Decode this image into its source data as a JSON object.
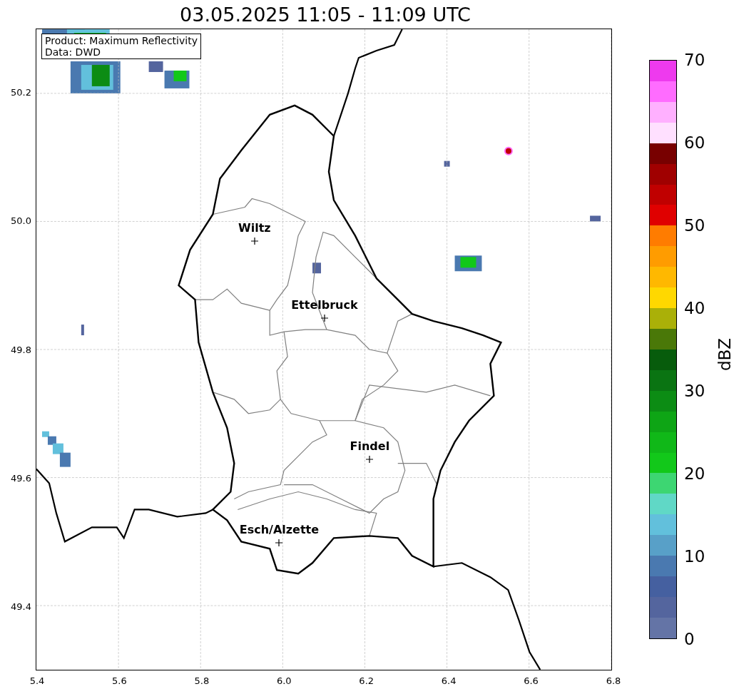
{
  "title": "03.05.2025 11:05 - 11:09 UTC",
  "info_box": [
    "Product: Maximum Reflectivity",
    "Data: DWD"
  ],
  "cities": [
    {
      "name": "Wiltz"
    },
    {
      "name": "Ettelbruck"
    },
    {
      "name": "Findel"
    },
    {
      "name": "Esch/Alzette"
    }
  ],
  "y_ticks": [
    "50.2",
    "50.0",
    "49.8",
    "49.6",
    "49.4"
  ],
  "colorbar": {
    "ticks": [
      "70",
      "60",
      "50",
      "40",
      "30",
      "20",
      "10",
      "0"
    ],
    "label": "dBZ",
    "bands": [
      {
        "color": "#ee3aee"
      },
      {
        "color": "#ff6cff"
      },
      {
        "color": "#ffb0ff"
      },
      {
        "color": "#ffe0ff"
      },
      {
        "color": "#780000"
      },
      {
        "color": "#a00000"
      },
      {
        "color": "#c00000"
      },
      {
        "color": "#e00000"
      },
      {
        "color": "#ff7c00"
      },
      {
        "color": "#ff9c00"
      },
      {
        "color": "#ffb800"
      },
      {
        "color": "#ffd800"
      },
      {
        "color": "#aab008"
      },
      {
        "color": "#4a7808"
      },
      {
        "color": "#075c0c"
      },
      {
        "color": "#0a7412"
      },
      {
        "color": "#0c8c14"
      },
      {
        "color": "#0ea515"
      },
      {
        "color": "#10b818"
      },
      {
        "color": "#12c81a"
      },
      {
        "color": "#3dd672"
      },
      {
        "color": "#60d8c6"
      },
      {
        "color": "#62c0dc"
      },
      {
        "color": "#58a0c8"
      },
      {
        "color": "#4a79b0"
      },
      {
        "color": "#4560a0"
      },
      {
        "color": "#54659e"
      },
      {
        "color": "#6474a6"
      }
    ]
  },
  "x_ticks": [
    "5.4",
    "5.6",
    "5.8",
    "6.0",
    "6.2",
    "6.4",
    "6.6",
    "6.8"
  ]
}
